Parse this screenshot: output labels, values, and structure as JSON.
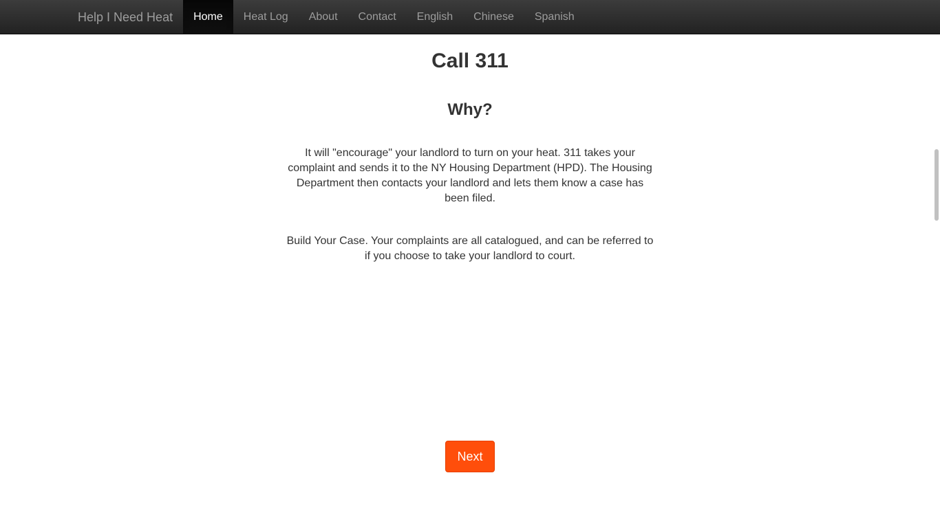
{
  "navbar": {
    "brand": "Help I Need Heat",
    "items": [
      {
        "label": "Home",
        "active": true
      },
      {
        "label": "Heat Log",
        "active": false
      },
      {
        "label": "About",
        "active": false
      },
      {
        "label": "Contact",
        "active": false
      },
      {
        "label": "English",
        "active": false
      },
      {
        "label": "Chinese",
        "active": false
      },
      {
        "label": "Spanish",
        "active": false
      }
    ]
  },
  "main": {
    "title": "Call 311",
    "subtitle": "Why?",
    "paragraphs": [
      "It will \"encourage\" your landlord to turn on your heat. 311 takes your complaint and sends it to the NY Housing Department (HPD). The Housing Department then contacts your landlord and lets them know a case has been filed.",
      "Build Your Case. Your complaints are all catalogued, and can be referred to if you choose to take your landlord to court."
    ],
    "next_label": "Next"
  },
  "colors": {
    "navbar_bg": "#222222",
    "nav_text": "#9d9d9d",
    "nav_active_text": "#ffffff",
    "button_bg": "#ff4e0b",
    "text": "#333333"
  }
}
